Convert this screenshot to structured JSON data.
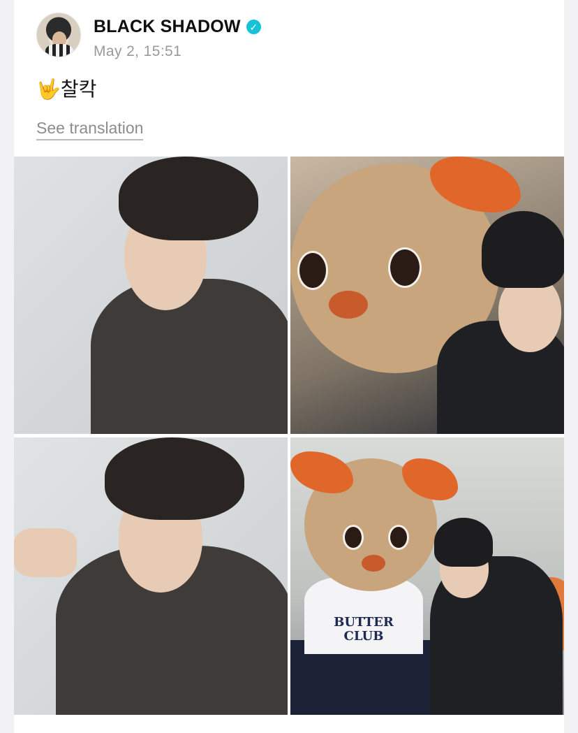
{
  "post": {
    "author_name": "BLACK SHADOW",
    "verified_icon": "✓",
    "timestamp": "May 2, 15:51",
    "text": "🤟찰칵",
    "see_translation": "See translation"
  },
  "media": {
    "items": [
      "selfie-grey-cardigan",
      "selfie-with-mascot",
      "selfie-peace-sign",
      "mascot-butter-club"
    ],
    "mascot_shirt_text": "BUTTER CLUB"
  },
  "colors": {
    "verified": "#15c2d6",
    "mascot_bow": "#e0662a"
  }
}
